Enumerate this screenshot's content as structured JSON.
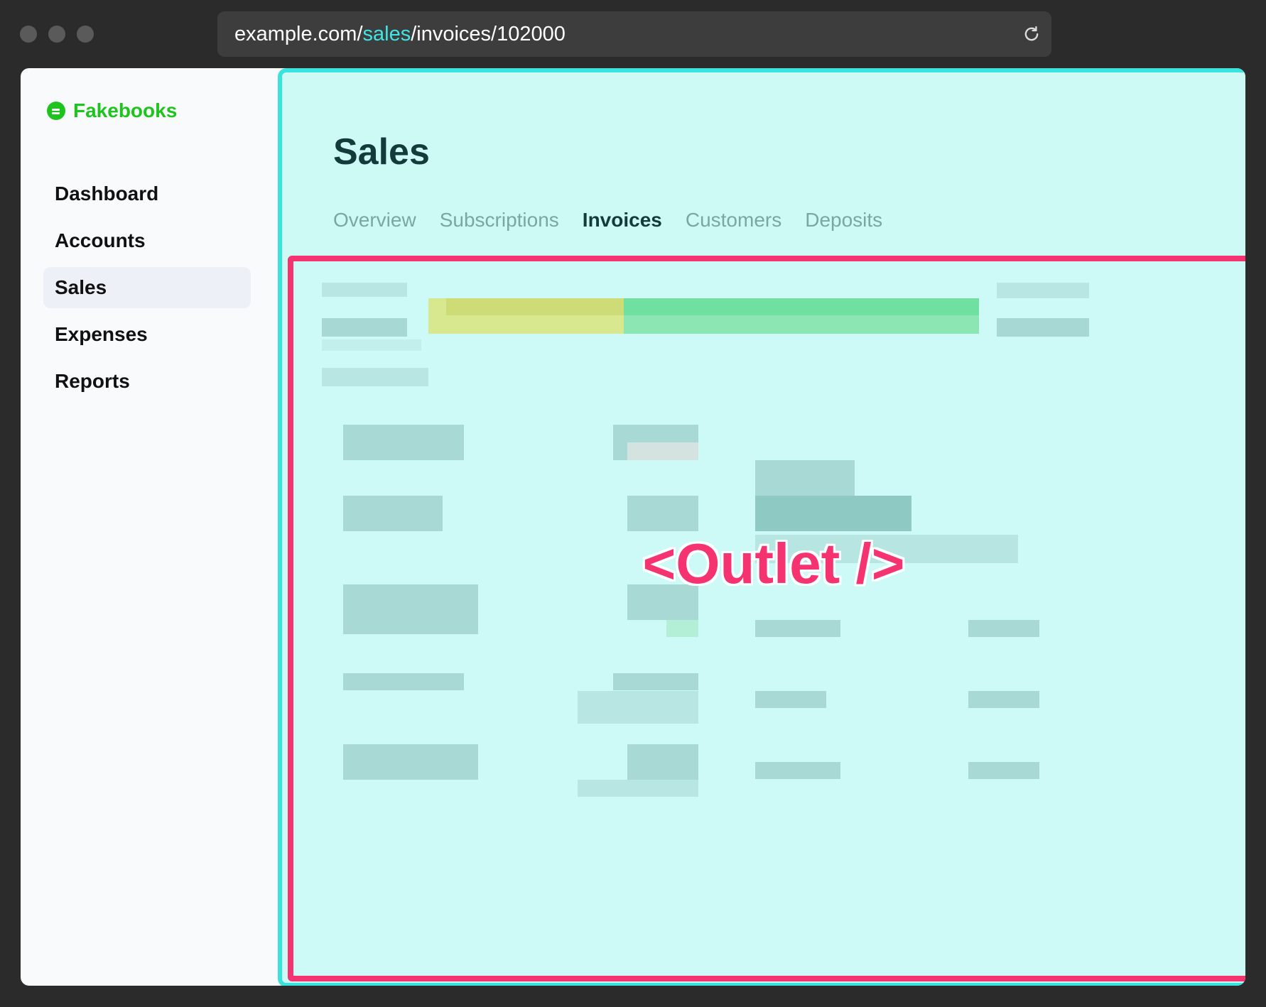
{
  "browser": {
    "url_prefix": "example.com/",
    "url_highlight": "sales",
    "url_suffix": "/invoices/102000",
    "reload_icon": "reload-icon"
  },
  "app": {
    "logo_text": "Fakebooks",
    "nav": [
      {
        "label": "Dashboard",
        "active": false
      },
      {
        "label": "Accounts",
        "active": false
      },
      {
        "label": "Sales",
        "active": true
      },
      {
        "label": "Expenses",
        "active": false
      },
      {
        "label": "Reports",
        "active": false
      }
    ]
  },
  "sales": {
    "title": "Sales",
    "tabs": [
      {
        "label": "Overview",
        "active": false
      },
      {
        "label": "Subscriptions",
        "active": false
      },
      {
        "label": "Invoices",
        "active": true
      },
      {
        "label": "Customers",
        "active": false
      },
      {
        "label": "Deposits",
        "active": false
      }
    ]
  },
  "outlet": {
    "label": "<Outlet />"
  },
  "colors": {
    "sales_highlight": "#3be3dd",
    "outlet_highlight": "#f53370",
    "brand": "#1ec41e"
  }
}
